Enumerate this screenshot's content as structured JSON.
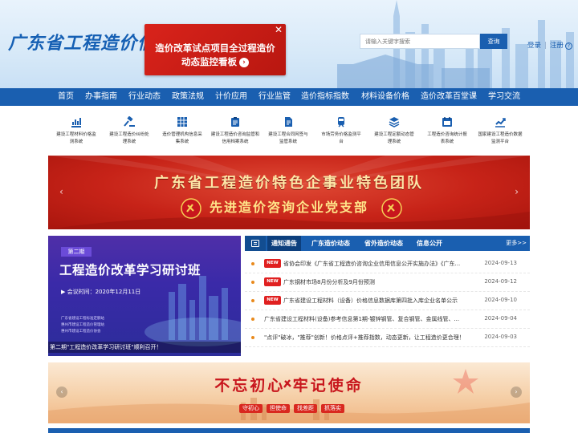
{
  "header": {
    "logo": "广东省工程造价信息",
    "promo": {
      "line1": "造价改革试点项目全过程造价",
      "line2": "动态监控看板",
      "arrow": "›",
      "close": "✕"
    },
    "search_placeholder": "请输入关键字搜索",
    "search_button": "查询",
    "login": "登录",
    "register": "注册",
    "help": "?"
  },
  "nav": [
    "首页",
    "办事指南",
    "行业动态",
    "政策法规",
    "计价应用",
    "行业监管",
    "造价指标指数",
    "材料设备价格",
    "造价改革百堂课",
    "学习交流"
  ],
  "quick_links": [
    {
      "icon": "chart-icon",
      "label1": "建设工程材料价格监",
      "label2": "测系统"
    },
    {
      "icon": "gavel-icon",
      "label1": "建设工程造价纠纷处",
      "label2": "理系统"
    },
    {
      "icon": "grid-icon",
      "label1": "造价管理机构信息采",
      "label2": "集系统"
    },
    {
      "icon": "clipboard-icon",
      "label1": "建设工程造价咨询监管和",
      "label2": "信用档案系统"
    },
    {
      "icon": "document-icon",
      "label1": "建设工程合同网签与",
      "label2": "监管系统"
    },
    {
      "icon": "train-icon",
      "label1": "市场劳务价格监测平",
      "label2": "台"
    },
    {
      "icon": "layers-icon",
      "label1": "建设工程定额动态管",
      "label2": "理系统"
    },
    {
      "icon": "calendar-icon",
      "label1": "工程造价咨询统计报",
      "label2": "表系统"
    },
    {
      "icon": "trend-icon",
      "label1": "国家建设工程造价数据",
      "label2": "监测平台"
    }
  ],
  "banner1": {
    "title": "广东省工程造价特色企事业特色团队",
    "subtitle": "先进造价咨询企业党支部",
    "prev": "‹",
    "next": "›"
  },
  "left_image": {
    "tag": "第二期",
    "title": "工程造价改革学习研讨班",
    "date": "▶ 会议时间：2020年12月11日",
    "org1": "广东省建设工程标准定额站",
    "org2": "惠州市建设工程造价管理站",
    "org3": "惠州市建设工程造价协会",
    "caption": "第二期\"工程造价改革学习研讨班\"顺利召开！"
  },
  "news": {
    "tabs": [
      "通知通告",
      "广东造价动态",
      "省外造价动态",
      "信息公开"
    ],
    "more": "更多>>",
    "new_badge": "NEW",
    "items": [
      {
        "is_new": true,
        "title": "省协会印发《广东省工程造价咨询企业信用信息公开实施办法》《广东...",
        "date": "2024-09-13"
      },
      {
        "is_new": true,
        "title": "广东钢材市场8月份分析及9月份预测",
        "date": "2024-09-12"
      },
      {
        "is_new": true,
        "title": "广东省建设工程材料（设备）价格信息数据库第四批入库企业名单公示",
        "date": "2024-09-10"
      },
      {
        "is_new": false,
        "title": "广东省建设工程材料(设备)参考信息第1期-镀锌钢管、复合钢管、金属线管、...",
        "date": "2024-09-04"
      },
      {
        "is_new": false,
        "title": "\"点评\"破冰，\"推荐\"创新！价格点评+推荐指数，动态更新，让工程造价更合理！",
        "date": "2024-09-03"
      }
    ]
  },
  "banner2": {
    "title": "不忘初心  牢记使命",
    "pills": [
      "守初心",
      "担使命",
      "找差距",
      "抓落实"
    ],
    "prev": "‹",
    "next": "›"
  },
  "colors": {
    "primary": "#1a5fb0",
    "red": "#c72318",
    "purple": "#3a2aa8"
  }
}
